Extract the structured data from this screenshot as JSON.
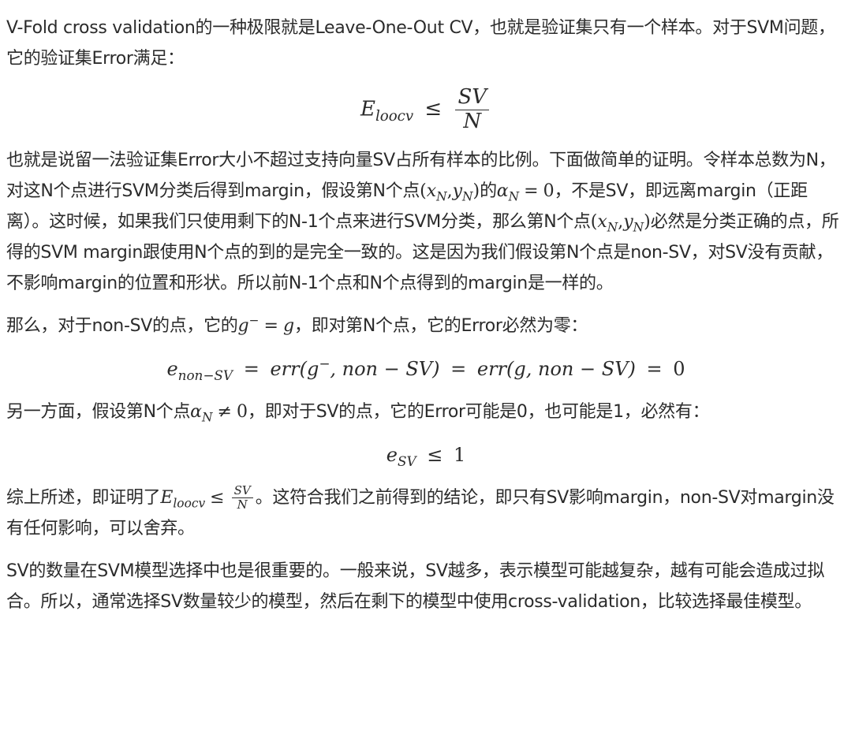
{
  "paragraphs": {
    "p1": "V-Fold cross validation的一种极限就是Leave-One-Out CV，也就是验证集只有一个样本。对于SVM问题，它的验证集Error满足：",
    "p2_a": "也就是说留一法验证集Error大小不超过支持向量SV占所有样本的比例。下面做简单的证明。令样本总数为N，对这N个点进行SVM分类后得到margin，假设第N个点",
    "p2_b": "的",
    "p2_c": "，不是SV，即远离margin（正距离）。这时候，如果我们只使用剩下的N-1个点来进行SVM分类，那么第N个点",
    "p2_d": "必然是分类正确的点，所得的SVM margin跟使用N个点的到的是完全一致的。这是因为我们假设第N个点是non-SV，对SV没有贡献，不影响margin的位置和形状。所以前N-1个点和N个点得到的margin是一样的。",
    "p3_a": "那么，对于non-SV的点，它的",
    "p3_b": "，即对第N个点，它的Error必然为零：",
    "p4_a": "另一方面，假设第N个点",
    "p4_b": "，即对于SV的点，它的Error可能是0，也可能是1，必然有：",
    "p5_a": "综上所述，即证明了",
    "p5_b": "。这符合我们之前得到的结论，即只有SV影响margin，non-SV对margin没有任何影响，可以舍弃。",
    "p6": "SV的数量在SVM模型选择中也是很重要的。一般来说，SV越多，表示模型可能越复杂，越有可能会造成过拟合。所以，通常选择SV数量较少的模型，然后在剩下的模型中使用cross-validation，比较选择最佳模型。"
  },
  "math": {
    "E": "E",
    "loocv": "loocv",
    "leq": "≤",
    "neq": "≠",
    "eq": "=",
    "SV": "SV",
    "N": "N",
    "point_open": "(",
    "x": "x",
    "comma": ",",
    "y": "y",
    "point_close": ")",
    "alpha": "α",
    "zero": "0",
    "one": "1",
    "g": "g",
    "minus_sup": "−",
    "e": "e",
    "non_SV_sub": "non−SV",
    "err_expr_1": "err(g",
    "err_expr_tail_1": ", non − SV)",
    "err_expr_2": "err(g, non − SV)"
  }
}
